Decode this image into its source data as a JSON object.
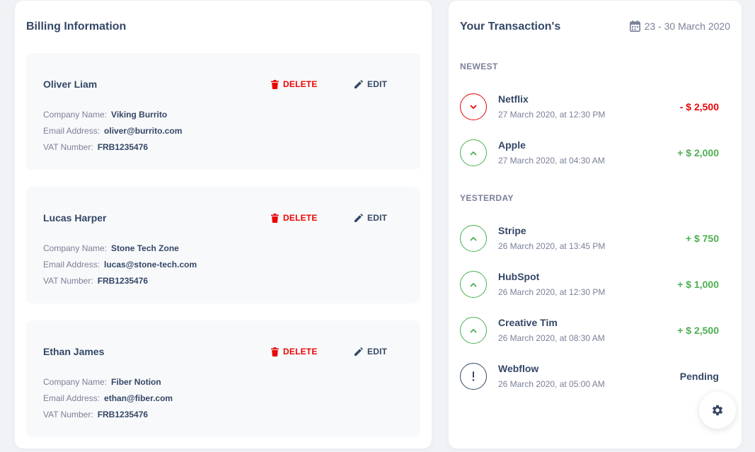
{
  "billing": {
    "title": "Billing Information",
    "delete_label": "DELETE",
    "edit_label": "EDIT",
    "company_label": "Company Name:",
    "email_label": "Email Address:",
    "vat_label": "VAT Number:",
    "items": [
      {
        "name": "Oliver Liam",
        "company": "Viking Burrito",
        "email": "oliver@burrito.com",
        "vat": "FRB1235476"
      },
      {
        "name": "Lucas Harper",
        "company": "Stone Tech Zone",
        "email": "lucas@stone-tech.com",
        "vat": "FRB1235476"
      },
      {
        "name": "Ethan James",
        "company": "Fiber Notion",
        "email": "ethan@fiber.com",
        "vat": "FRB1235476"
      }
    ]
  },
  "transactions": {
    "title": "Your Transaction's",
    "date_range": "23 - 30 March 2020",
    "sections": [
      {
        "label": "NEWEST",
        "items": [
          {
            "name": "Netflix",
            "date": "27 March 2020, at 12:30 PM",
            "amount": "- $ 2,500",
            "type": "down"
          },
          {
            "name": "Apple",
            "date": "27 March 2020, at 04:30 AM",
            "amount": "+ $ 2,000",
            "type": "up"
          }
        ]
      },
      {
        "label": "YESTERDAY",
        "items": [
          {
            "name": "Stripe",
            "date": "26 March 2020, at 13:45 PM",
            "amount": "+ $ 750",
            "type": "up"
          },
          {
            "name": "HubSpot",
            "date": "26 March 2020, at 12:30 PM",
            "amount": "+ $ 1,000",
            "type": "up"
          },
          {
            "name": "Creative Tim",
            "date": "26 March 2020, at 08:30 AM",
            "amount": "+ $ 2,500",
            "type": "up"
          },
          {
            "name": "Webflow",
            "date": "26 March 2020, at 05:00 AM",
            "amount": "Pending",
            "type": "pending"
          }
        ]
      }
    ]
  },
  "icons": {
    "delete": "trash-icon",
    "edit": "pencil-icon",
    "calendar": "calendar-icon",
    "down": "chevron-down-icon",
    "up": "chevron-up-icon",
    "pending": "exclamation-icon",
    "settings": "gear-icon"
  },
  "colors": {
    "danger": "#ea0606",
    "success": "#4caf50",
    "text": "#344767",
    "muted": "#7b809a"
  }
}
